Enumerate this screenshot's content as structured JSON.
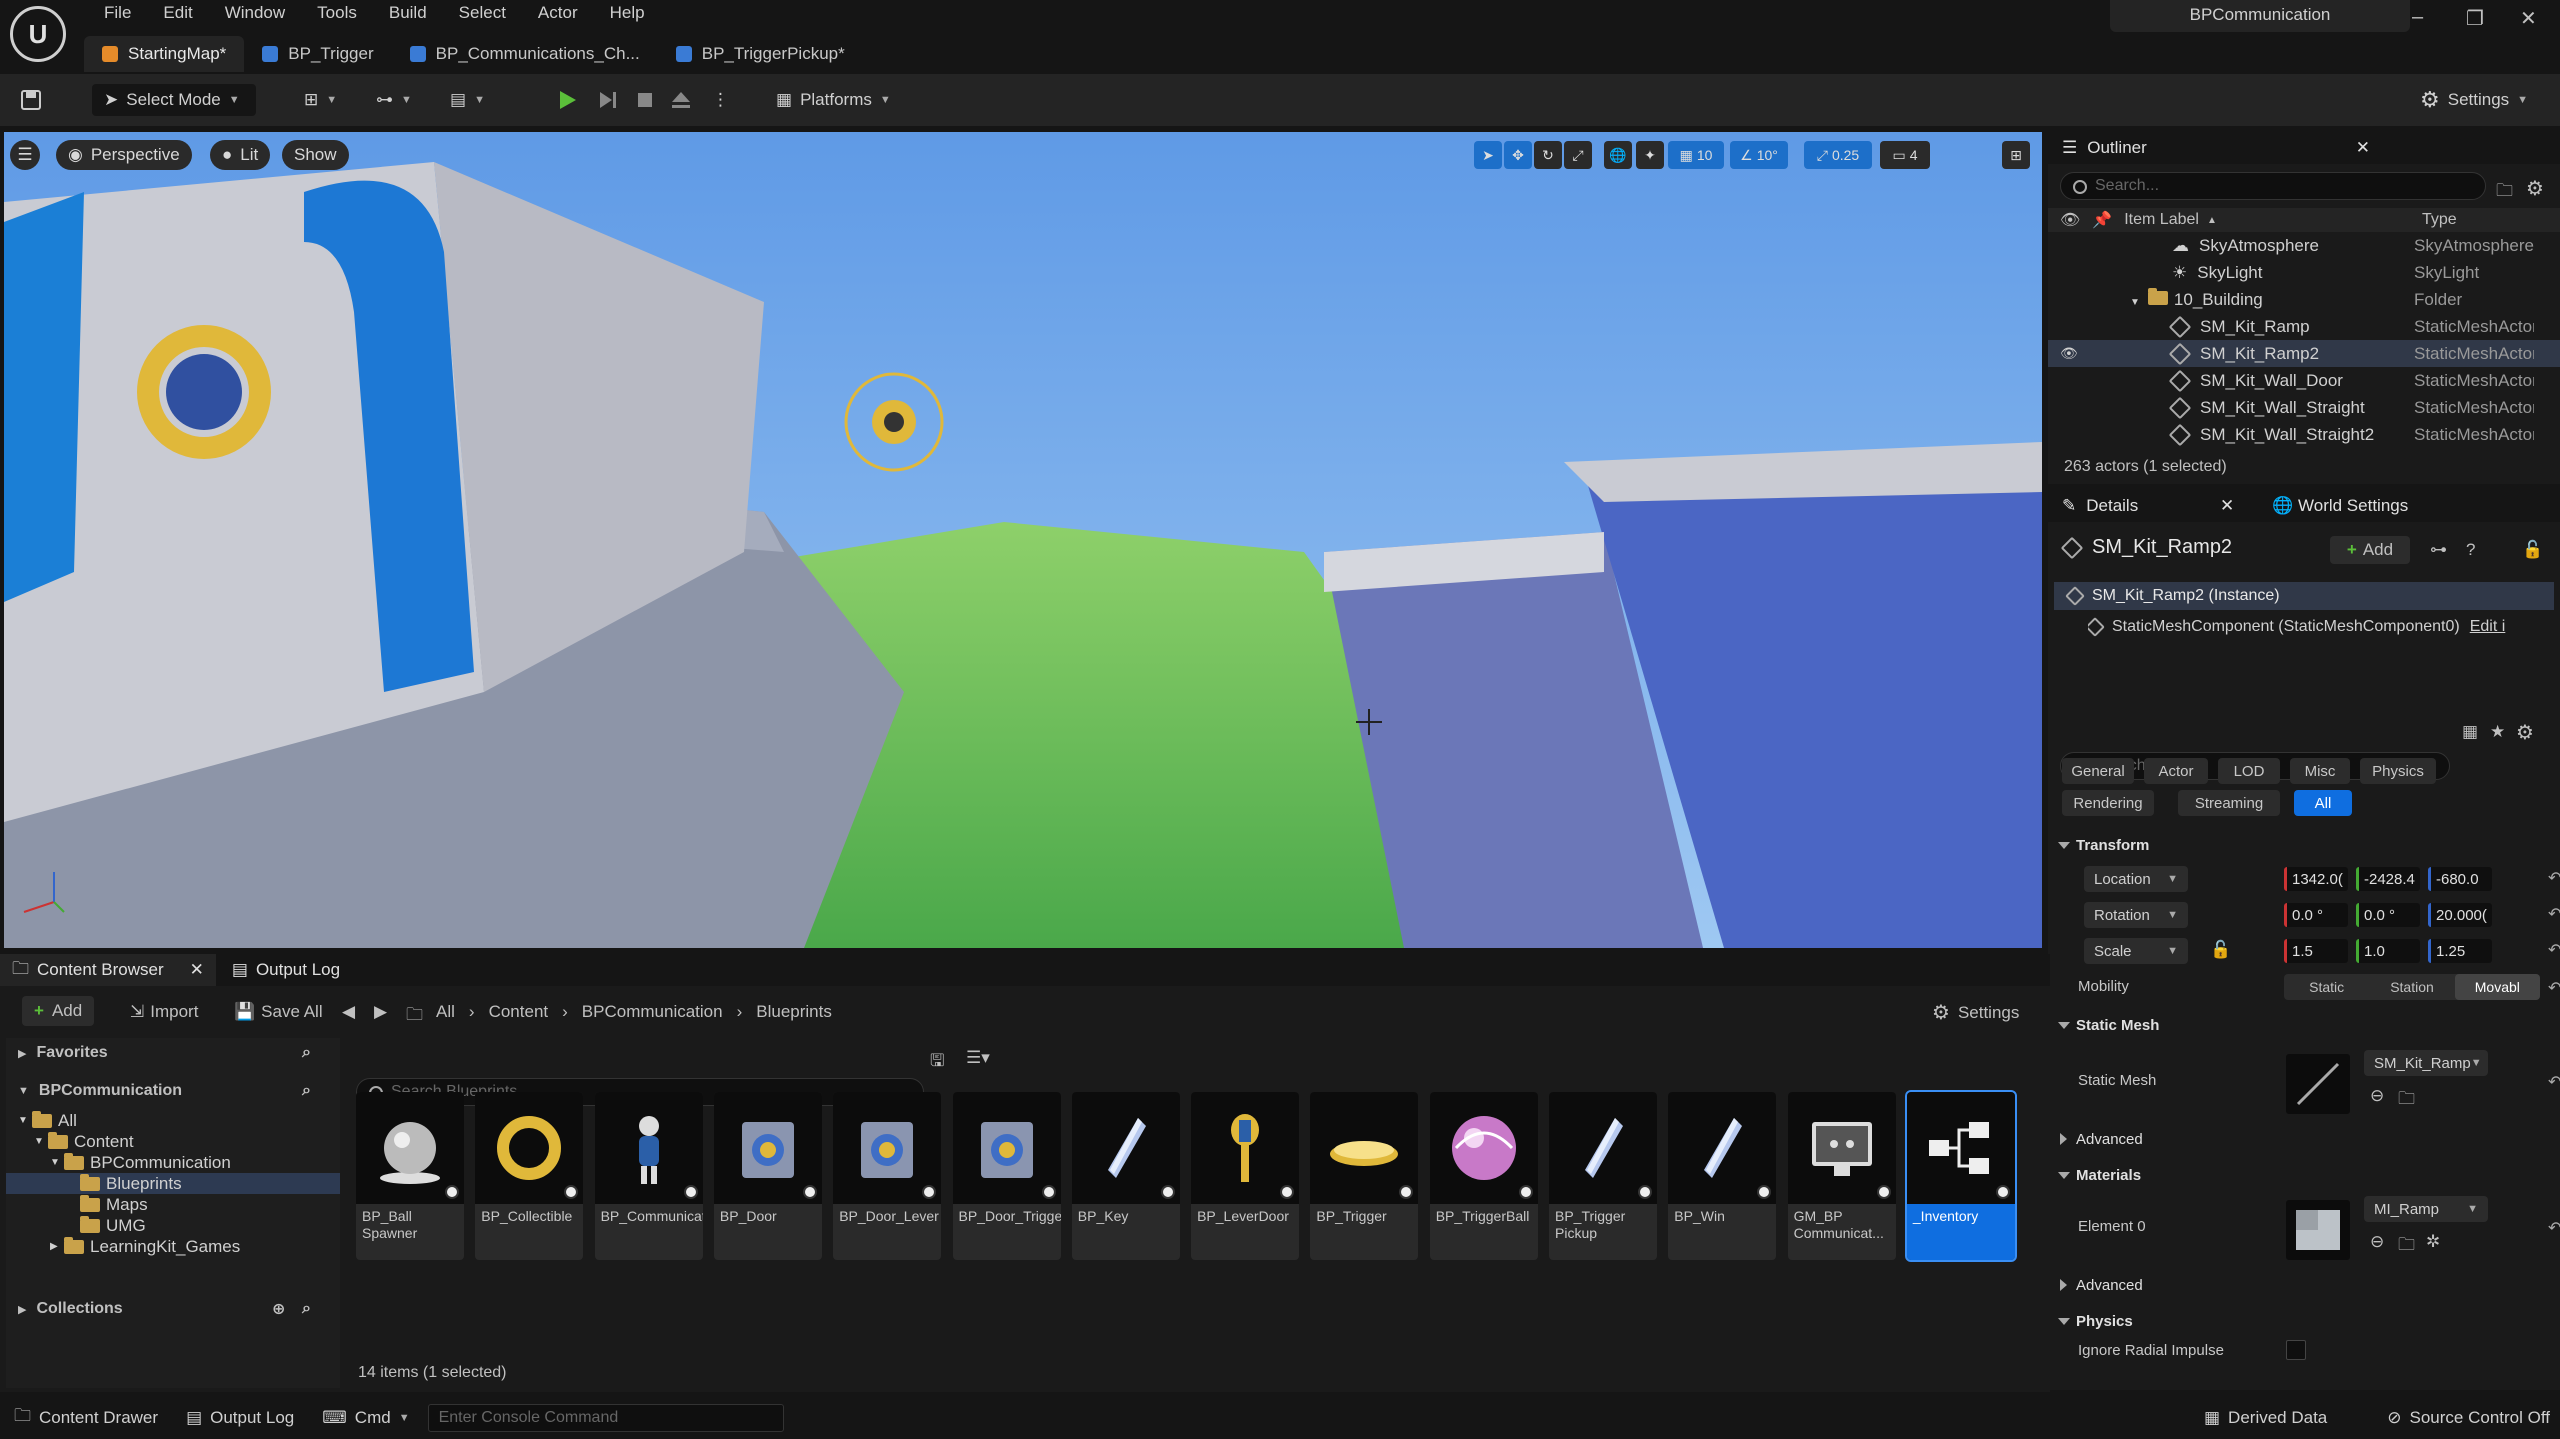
{
  "menu": [
    "File",
    "Edit",
    "Window",
    "Tools",
    "Build",
    "Select",
    "Actor",
    "Help"
  ],
  "tabs": [
    {
      "label": "StartingMap*",
      "color": "#e58b2a"
    },
    {
      "label": "BP_Trigger",
      "color": "#3a7bd5"
    },
    {
      "label": "BP_Communications_Ch...",
      "color": "#3a7bd5"
    },
    {
      "label": "BP_TriggerPickup*",
      "color": "#3a7bd5"
    }
  ],
  "project_name": "BPCommunication",
  "toolbar": {
    "select_mode": "Select Mode",
    "platforms": "Platforms",
    "settings": "Settings"
  },
  "viewport": {
    "perspective": "Perspective",
    "lit": "Lit",
    "show": "Show",
    "grid_snap": "10",
    "rot_snap": "10°",
    "scale_snap": "0.25",
    "cam_speed": "4"
  },
  "outliner": {
    "title": "Outliner",
    "search_placeholder": "Search...",
    "col_label": "Item Label",
    "col_type": "Type",
    "rows": [
      {
        "label": "SkyAtmosphere",
        "type": "SkyAtmosphere",
        "indent": 1,
        "icon": "sky"
      },
      {
        "label": "SkyLight",
        "type": "SkyLight",
        "indent": 1,
        "icon": "light"
      },
      {
        "label": "10_Building",
        "type": "Folder",
        "indent": 0,
        "icon": "folder"
      },
      {
        "label": "SM_Kit_Ramp",
        "type": "StaticMeshActor",
        "indent": 1,
        "icon": "mesh"
      },
      {
        "label": "SM_Kit_Ramp2",
        "type": "StaticMeshActor",
        "indent": 1,
        "icon": "mesh",
        "selected": true
      },
      {
        "label": "SM_Kit_Wall_Door",
        "type": "StaticMeshActor",
        "indent": 1,
        "icon": "mesh"
      },
      {
        "label": "SM_Kit_Wall_Straight",
        "type": "StaticMeshActor",
        "indent": 1,
        "icon": "mesh"
      },
      {
        "label": "SM_Kit_Wall_Straight2",
        "type": "StaticMeshActor",
        "indent": 1,
        "icon": "mesh"
      }
    ],
    "footer": "263 actors (1 selected)"
  },
  "details": {
    "tab": "Details",
    "world_tab": "World Settings",
    "actor": "SM_Kit_Ramp2",
    "add": "Add",
    "instance": "SM_Kit_Ramp2 (Instance)",
    "component": "StaticMeshComponent (StaticMeshComponent0)",
    "edit": "Edit i",
    "search_placeholder": "Search",
    "categories": [
      "General",
      "Actor",
      "LOD",
      "Misc",
      "Physics",
      "Rendering",
      "Streaming",
      "All"
    ],
    "transform": {
      "title": "Transform",
      "location": {
        "label": "Location",
        "x": "1342.0(",
        "y": "-2428.4",
        "z": "-680.0"
      },
      "rotation": {
        "label": "Rotation",
        "x": "0.0 °",
        "y": "0.0 °",
        "z": "20.000("
      },
      "scale": {
        "label": "Scale",
        "x": "1.5",
        "y": "1.0",
        "z": "1.25"
      },
      "mobility": {
        "label": "Mobility",
        "options": [
          "Static",
          "Station",
          "Movabl"
        ]
      }
    },
    "static_mesh": {
      "title": "Static Mesh",
      "label": "Static Mesh",
      "value": "SM_Kit_Ramp",
      "advanced": "Advanced"
    },
    "materials": {
      "title": "Materials",
      "label": "Element 0",
      "value": "MI_Ramp",
      "advanced": "Advanced"
    },
    "physics": {
      "title": "Physics",
      "label": "Ignore Radial Impulse"
    }
  },
  "content_browser": {
    "tab": "Content Browser",
    "output_tab": "Output Log",
    "add": "Add",
    "import": "Import",
    "save_all": "Save All",
    "breadcrumb": [
      "All",
      "Content",
      "BPCommunication",
      "Blueprints"
    ],
    "settings": "Settings",
    "favorites": "Favorites",
    "project": "BPCommunication",
    "tree": [
      {
        "label": "All",
        "indent": 0
      },
      {
        "label": "Content",
        "indent": 1
      },
      {
        "label": "BPCommunication",
        "indent": 2
      },
      {
        "label": "Blueprints",
        "indent": 3,
        "selected": true
      },
      {
        "label": "Maps",
        "indent": 3
      },
      {
        "label": "UMG",
        "indent": 3
      },
      {
        "label": "LearningKit_Games",
        "indent": 2
      }
    ],
    "collections": "Collections",
    "search_placeholder": "Search Blueprints",
    "assets": [
      {
        "label": "BP_Ball Spawner",
        "thumb": "sphere"
      },
      {
        "label": "BP_Collectible",
        "thumb": "ring"
      },
      {
        "label": "BP_Communicat..._Character",
        "thumb": "char"
      },
      {
        "label": "BP_Door",
        "thumb": "door"
      },
      {
        "label": "BP_Door_Lever",
        "thumb": "door"
      },
      {
        "label": "BP_Door_Trigger",
        "thumb": "door"
      },
      {
        "label": "BP_Key",
        "thumb": "key"
      },
      {
        "label": "BP_LeverDoor",
        "thumb": "lever"
      },
      {
        "label": "BP_Trigger",
        "thumb": "disc"
      },
      {
        "label": "BP_TriggerBall",
        "thumb": "ball"
      },
      {
        "label": "BP_Trigger Pickup",
        "thumb": "key"
      },
      {
        "label": "BP_Win",
        "thumb": "key"
      },
      {
        "label": "GM_BP Communicat...",
        "thumb": "gm"
      },
      {
        "label": "_Inventory",
        "thumb": "graph",
        "selected": true
      }
    ],
    "count": "14 items (1 selected)"
  },
  "statusbar": {
    "drawer": "Content Drawer",
    "output": "Output Log",
    "cmd": "Cmd",
    "console_placeholder": "Enter Console Command",
    "derived": "Derived Data",
    "source": "Source Control Off"
  }
}
